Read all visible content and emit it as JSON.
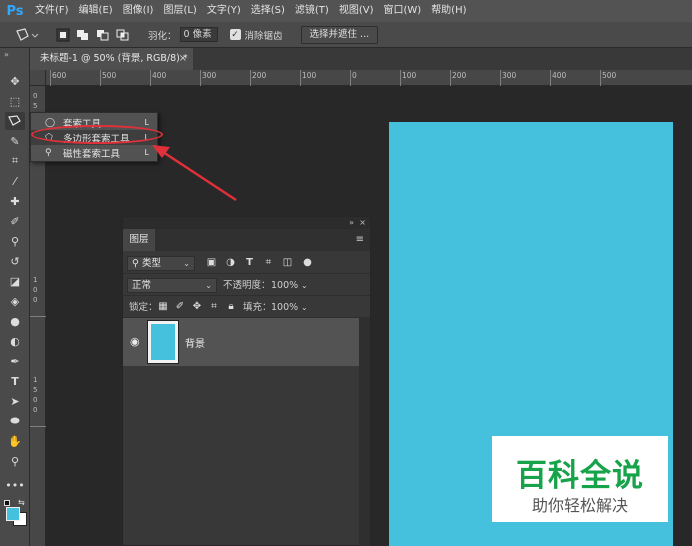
{
  "app": {
    "logo": "Ps"
  },
  "menubar": {
    "items": [
      "文件(F)",
      "编辑(E)",
      "图像(I)",
      "图层(L)",
      "文字(Y)",
      "选择(S)",
      "滤镜(T)",
      "视图(V)",
      "窗口(W)",
      "帮助(H)"
    ]
  },
  "options": {
    "feather_label": "羽化：",
    "feather_value": "0 像素",
    "antialias_label": "消除锯齿",
    "antialias_checked": true,
    "select_mask_label": "选择并遮住 ..."
  },
  "document": {
    "tab_title": "未标题-1 @ 50% (背景, RGB/8) *",
    "close_glyph": "×",
    "canvas_color": "#45c0dd"
  },
  "ruler": {
    "h_labels": [
      "600",
      "500",
      "400",
      "300",
      "200",
      "100",
      "0",
      "100",
      "200",
      "300",
      "400",
      "500"
    ],
    "v_labels": [
      "0",
      "5",
      "0",
      "1",
      "0",
      "0",
      "1",
      "5",
      "0",
      "0"
    ]
  },
  "tools": [
    "move-icon",
    "marquee-icon",
    "polygonal-lasso-icon",
    "quick-select-icon",
    "crop-icon",
    "eyedropper-icon",
    "healing-brush-icon",
    "brush-icon",
    "clone-stamp-icon",
    "history-brush-icon",
    "eraser-icon",
    "paint-bucket-icon",
    "blur-icon",
    "dodge-icon",
    "pen-icon",
    "type-icon",
    "path-select-icon",
    "ellipse-icon",
    "hand-icon",
    "zoom-icon",
    "more-icon"
  ],
  "lasso_flyout": {
    "items": [
      {
        "label": "套索工具",
        "key": "L",
        "icon": "lasso-icon"
      },
      {
        "label": "多边形套索工具",
        "key": "L",
        "icon": "polygonal-lasso-icon"
      },
      {
        "label": "磁性套索工具",
        "key": "L",
        "icon": "magnetic-lasso-icon"
      }
    ]
  },
  "layers_panel": {
    "tab_label": "图层",
    "filter_kind": "类型",
    "blend_mode": "正常",
    "opacity_label": "不透明度：",
    "opacity_value": "100%",
    "lock_label": "锁定：",
    "fill_label": "填充：",
    "fill_value": "100%",
    "layer_name": "背景"
  },
  "watermark": {
    "title": "百科全说",
    "subtitle": "助你轻松解决"
  },
  "colors": {
    "foreground": "#45c0dd",
    "background": "#ffffff",
    "annotation_red": "#e0303a",
    "watermark_green": "#16a34a"
  }
}
